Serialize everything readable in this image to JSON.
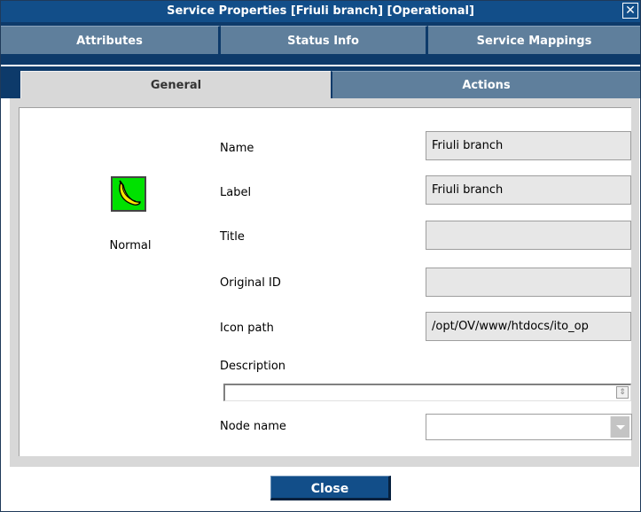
{
  "window": {
    "title": "Service Properties [Friuli branch] [Operational]",
    "close_icon": "close-icon"
  },
  "tabs_row1": [
    {
      "label": "Attributes"
    },
    {
      "label": "Status Info"
    },
    {
      "label": "Service Mappings"
    }
  ],
  "tabs_row2": [
    {
      "label": "General",
      "active": true
    },
    {
      "label": "Actions",
      "active": false
    }
  ],
  "status": {
    "icon": "banana-icon",
    "label": "Normal",
    "color": "#00e100"
  },
  "fields": {
    "name": {
      "label": "Name",
      "value": "Friuli branch"
    },
    "label": {
      "label": "Label",
      "value": "Friuli branch"
    },
    "title": {
      "label": "Title",
      "value": ""
    },
    "original_id": {
      "label": "Original ID",
      "value": ""
    },
    "icon_path": {
      "label": "Icon path",
      "value": "/opt/OV/www/htdocs/ito_op"
    },
    "description": {
      "label": "Description",
      "value": ""
    },
    "node_name": {
      "label": "Node name",
      "value": ""
    }
  },
  "footer": {
    "close_label": "Close"
  },
  "colors": {
    "titlebar": "#124e89",
    "tab_inactive": "#5f7f9c",
    "tab_active": "#d8d8d8",
    "frame": "#0d3a6a"
  }
}
